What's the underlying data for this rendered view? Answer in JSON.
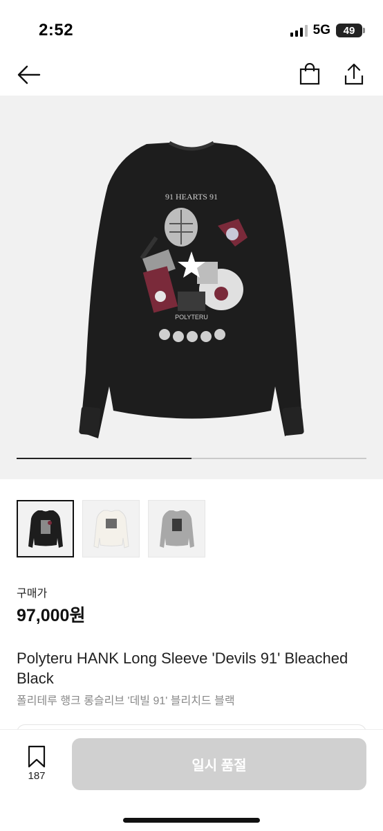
{
  "status_bar": {
    "time": "2:52",
    "network": "5G",
    "battery": "49"
  },
  "nav": {
    "back_icon": "arrow-left-icon",
    "bag_icon": "shopping-bag-icon",
    "share_icon": "share-icon"
  },
  "gallery": {
    "image_count": 3,
    "progress_fraction": 0.5
  },
  "thumbnails": [
    {
      "name": "black",
      "selected": true
    },
    {
      "name": "white",
      "selected": false
    },
    {
      "name": "gray",
      "selected": false
    }
  ],
  "price": {
    "label": "구매가",
    "value": "97,000원"
  },
  "product": {
    "name_en": "Polyteru HANK Long Sleeve 'Devils 91' Bleached Black",
    "name_ko": "폴리테루 행크 롱슬리브 '데빌 91' 블리치드 블랙"
  },
  "bottom_bar": {
    "wish_icon": "bookmark-icon",
    "wish_count": "187",
    "buy_label": "일시 품절"
  },
  "colors": {
    "button_disabled": "#d0d0d0",
    "hero_bg": "#f1f1f1",
    "text_secondary": "#888888"
  }
}
